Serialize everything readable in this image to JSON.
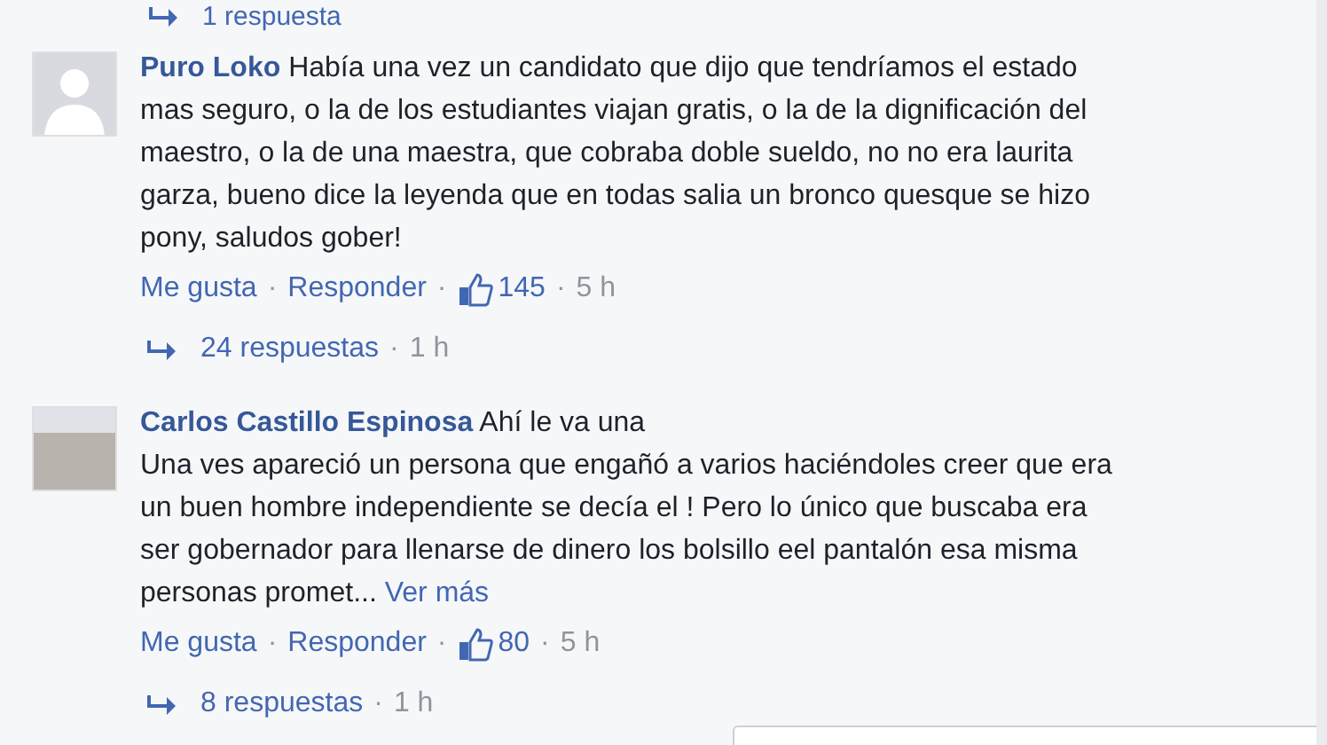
{
  "top_reply": {
    "label": "1 respuesta"
  },
  "comments": [
    {
      "author": "Puro Loko",
      "kind": "silhouette",
      "lines": [
        "Había una vez un candidato que dijo que tendríamos el estado",
        "mas seguro, o la de los estudiantes viajan gratis, o la de la dignificación del",
        "maestro, o la de una maestra, que cobraba doble sueldo, no no era laurita",
        "garza, bueno dice la leyenda que en todas salia un bronco quesque se hizo",
        "pony, saludos gober!"
      ],
      "like": "Me gusta",
      "sep": "·",
      "reply": "Responder",
      "likes": "145",
      "time": "5 h",
      "replies": "24 respuestas",
      "replies_time": "1 h"
    },
    {
      "author": "Carlos Castillo Espinosa",
      "kind": "photo",
      "lines": [
        "Ahí le va una",
        "Una ves apareció un persona que engañó a varios haciéndoles creer que era",
        "un buen hombre independiente se decía el ! Pero lo único que buscaba era",
        "ser gobernador para llenarse de dinero los bolsillo eel pantalón esa misma",
        "personas promet..."
      ],
      "more": "Ver más",
      "like": "Me gusta",
      "sep": "·",
      "reply": "Responder",
      "likes": "80",
      "time": "5 h",
      "replies": "8 respuestas",
      "replies_time": "1 h"
    }
  ]
}
